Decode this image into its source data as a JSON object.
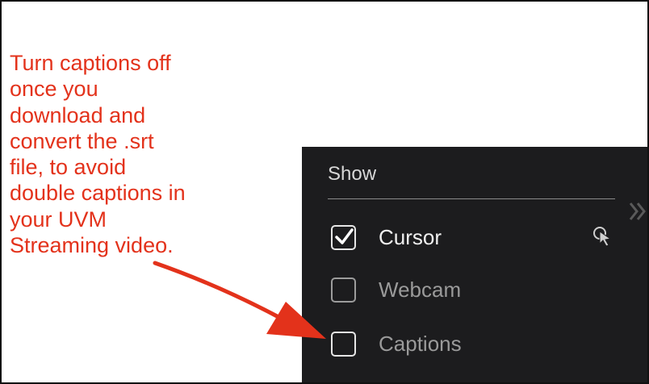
{
  "annotation": {
    "text": "Turn captions off\nonce you\ndownload and\nconvert the .srt\nfile, to avoid\ndouble captions in\nyour UVM\nStreaming video.",
    "color": "#e3321b"
  },
  "panel": {
    "title": "Show",
    "background": "#1c1c1e",
    "options": [
      {
        "label": "Cursor",
        "checked": true,
        "icon": "cursor-click-icon"
      },
      {
        "label": "Webcam",
        "checked": false
      },
      {
        "label": "Captions",
        "checked": false
      }
    ],
    "expand_icon": "double-chevron-right-icon"
  }
}
